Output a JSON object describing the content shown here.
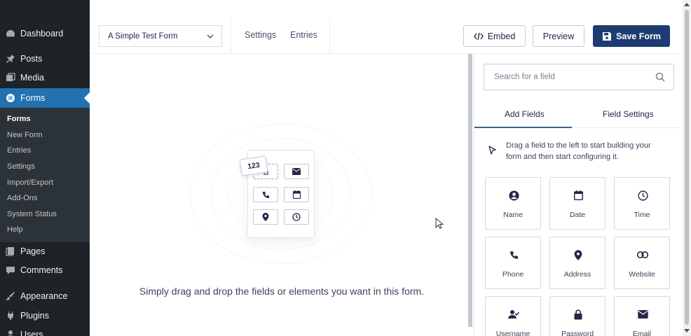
{
  "sidebar": {
    "items": [
      {
        "label": "Dashboard",
        "icon": "dashboard-icon"
      },
      {
        "label": "Posts",
        "icon": "pin-icon"
      },
      {
        "label": "Media",
        "icon": "media-icon"
      },
      {
        "label": "Forms",
        "icon": "forms-icon"
      },
      {
        "label": "Pages",
        "icon": "pages-icon"
      },
      {
        "label": "Comments",
        "icon": "comment-icon"
      },
      {
        "label": "Appearance",
        "icon": "brush-icon"
      },
      {
        "label": "Plugins",
        "icon": "plugin-icon"
      },
      {
        "label": "Users",
        "icon": "users-icon"
      }
    ],
    "submenu": [
      "Forms",
      "New Form",
      "Entries",
      "Settings",
      "Import/Export",
      "Add-Ons",
      "System Status",
      "Help"
    ]
  },
  "toolbar": {
    "form_name": "A Simple Test Form",
    "settings_label": "Settings",
    "entries_label": "Entries",
    "embed_label": "Embed",
    "preview_label": "Preview",
    "save_label": "Save Form"
  },
  "canvas": {
    "number_tag": "123",
    "message": "Simply drag and drop the fields or elements you want in this form."
  },
  "panel": {
    "search_placeholder": "Search for a field",
    "tabs": [
      "Add Fields",
      "Field Settings"
    ],
    "hint": "Drag a field to the left to start building your form and then start configuring it.",
    "fields": [
      {
        "label": "Name",
        "icon": "person-icon"
      },
      {
        "label": "Date",
        "icon": "calendar-icon"
      },
      {
        "label": "Time",
        "icon": "clock-icon"
      },
      {
        "label": "Phone",
        "icon": "phone-icon"
      },
      {
        "label": "Address",
        "icon": "map-pin-icon"
      },
      {
        "label": "Website",
        "icon": "link-icon"
      },
      {
        "label": "Username",
        "icon": "user-check-icon"
      },
      {
        "label": "Password",
        "icon": "lock-icon"
      },
      {
        "label": "Email",
        "icon": "envelope-icon"
      }
    ]
  },
  "colors": {
    "wp_sidebar": "#1d2327",
    "wp_active": "#2271b1",
    "save_button": "#1e3c72"
  }
}
